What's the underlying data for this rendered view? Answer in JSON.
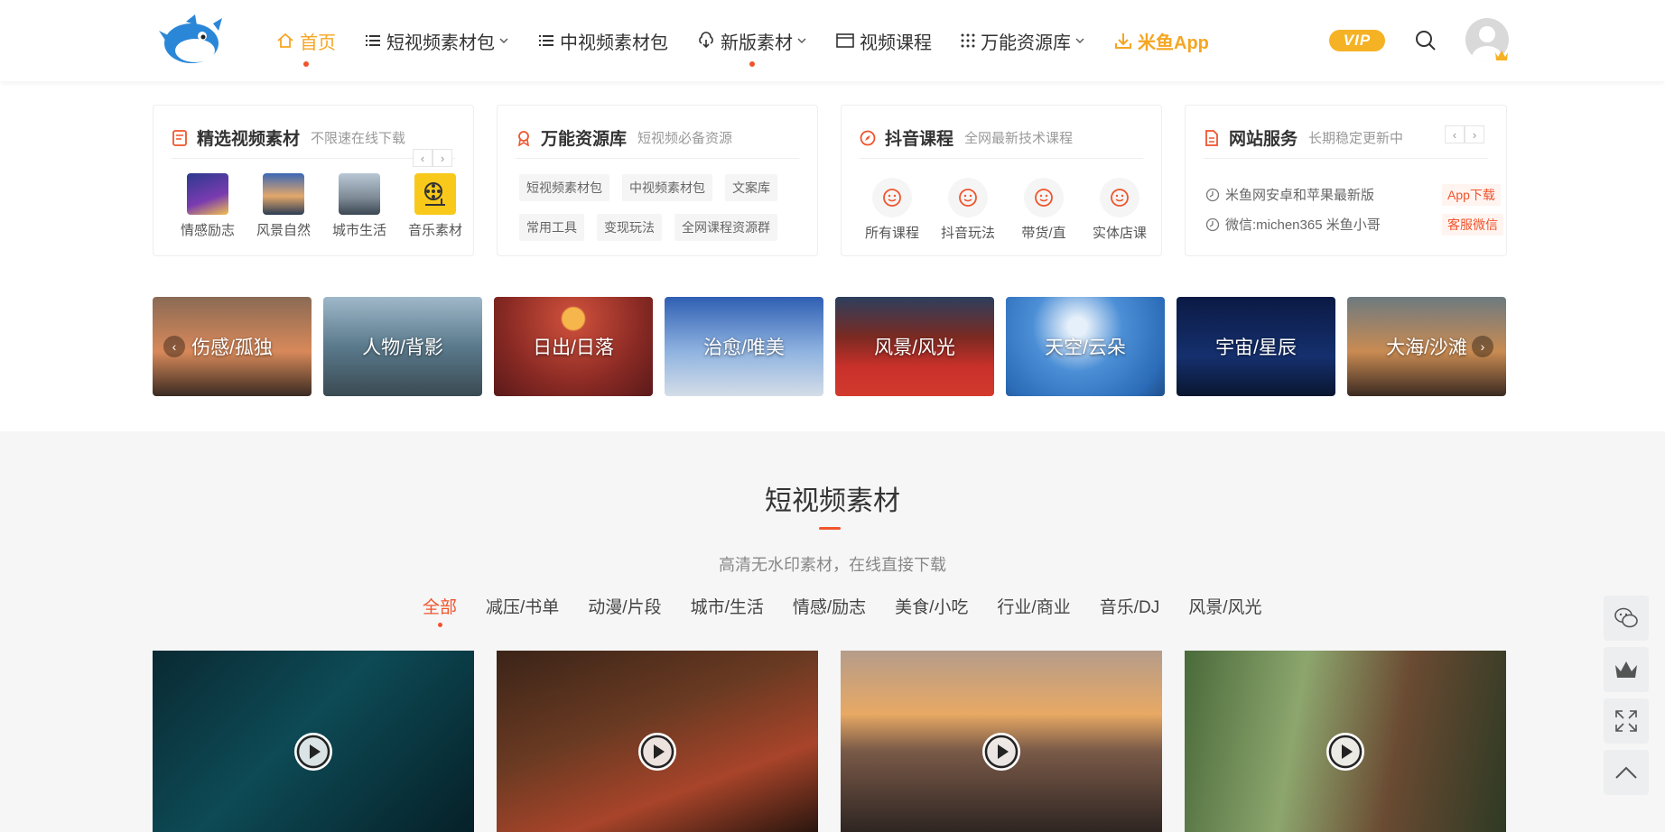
{
  "header": {
    "nav": [
      {
        "label": "首页",
        "icon": "home-icon",
        "active": true,
        "dot": true
      },
      {
        "label": "短视频素材包",
        "icon": "list-icon",
        "dropdown": true
      },
      {
        "label": "中视频素材包",
        "icon": "list-icon"
      },
      {
        "label": "新版素材",
        "icon": "cloud-download-icon",
        "dropdown": true,
        "dot": true
      },
      {
        "label": "视频课程",
        "icon": "video-window-icon"
      },
      {
        "label": "万能资源库",
        "icon": "grid-dots-icon",
        "dropdown": true
      },
      {
        "label": "米鱼App",
        "icon": "download-icon",
        "highlight": true
      }
    ],
    "vip_label": "VIP"
  },
  "cards": {
    "featured": {
      "title": "精选视频素材",
      "subtitle": "不限速在线下载",
      "items": [
        {
          "label": "情感励志"
        },
        {
          "label": "风景自然"
        },
        {
          "label": "城市生活"
        },
        {
          "label": "音乐素材"
        }
      ]
    },
    "resources": {
      "title": "万能资源库",
      "subtitle": "短视频必备资源",
      "tags": [
        "短视频素材包",
        "中视频素材包",
        "文案库",
        "常用工具",
        "变现玩法",
        "全网课程资源群"
      ]
    },
    "douyin": {
      "title": "抖音课程",
      "subtitle": "全网最新技术课程",
      "items": [
        {
          "label": "所有课程"
        },
        {
          "label": "抖音玩法"
        },
        {
          "label": "带货/直"
        },
        {
          "label": "实体店课"
        }
      ]
    },
    "service": {
      "title": "网站服务",
      "subtitle": "长期稳定更新中",
      "rows": [
        {
          "text": "米鱼网安卓和苹果最新版",
          "link": "App下载"
        },
        {
          "text": "微信:michen365 米鱼小哥",
          "link": "客服微信"
        }
      ]
    }
  },
  "strip": {
    "tiles": [
      {
        "label": "伤感/孤独"
      },
      {
        "label": "人物/背影"
      },
      {
        "label": "日出/日落"
      },
      {
        "label": "治愈/唯美"
      },
      {
        "label": "风景/风光"
      },
      {
        "label": "天空/云朵"
      },
      {
        "label": "宇宙/星辰"
      },
      {
        "label": "大海/沙滩"
      }
    ]
  },
  "section": {
    "title": "短视频素材",
    "subtitle": "高清无水印素材，在线直接下载",
    "filters": [
      "全部",
      "减压/书单",
      "动漫/片段",
      "城市/生活",
      "情感/励志",
      "美食/小吃",
      "行业/商业",
      "音乐/DJ",
      "风景/风光"
    ],
    "active_filter": 0
  },
  "colors": {
    "accent": "#f0542d",
    "active_nav": "#f5a623",
    "vip": "#f5b224"
  }
}
